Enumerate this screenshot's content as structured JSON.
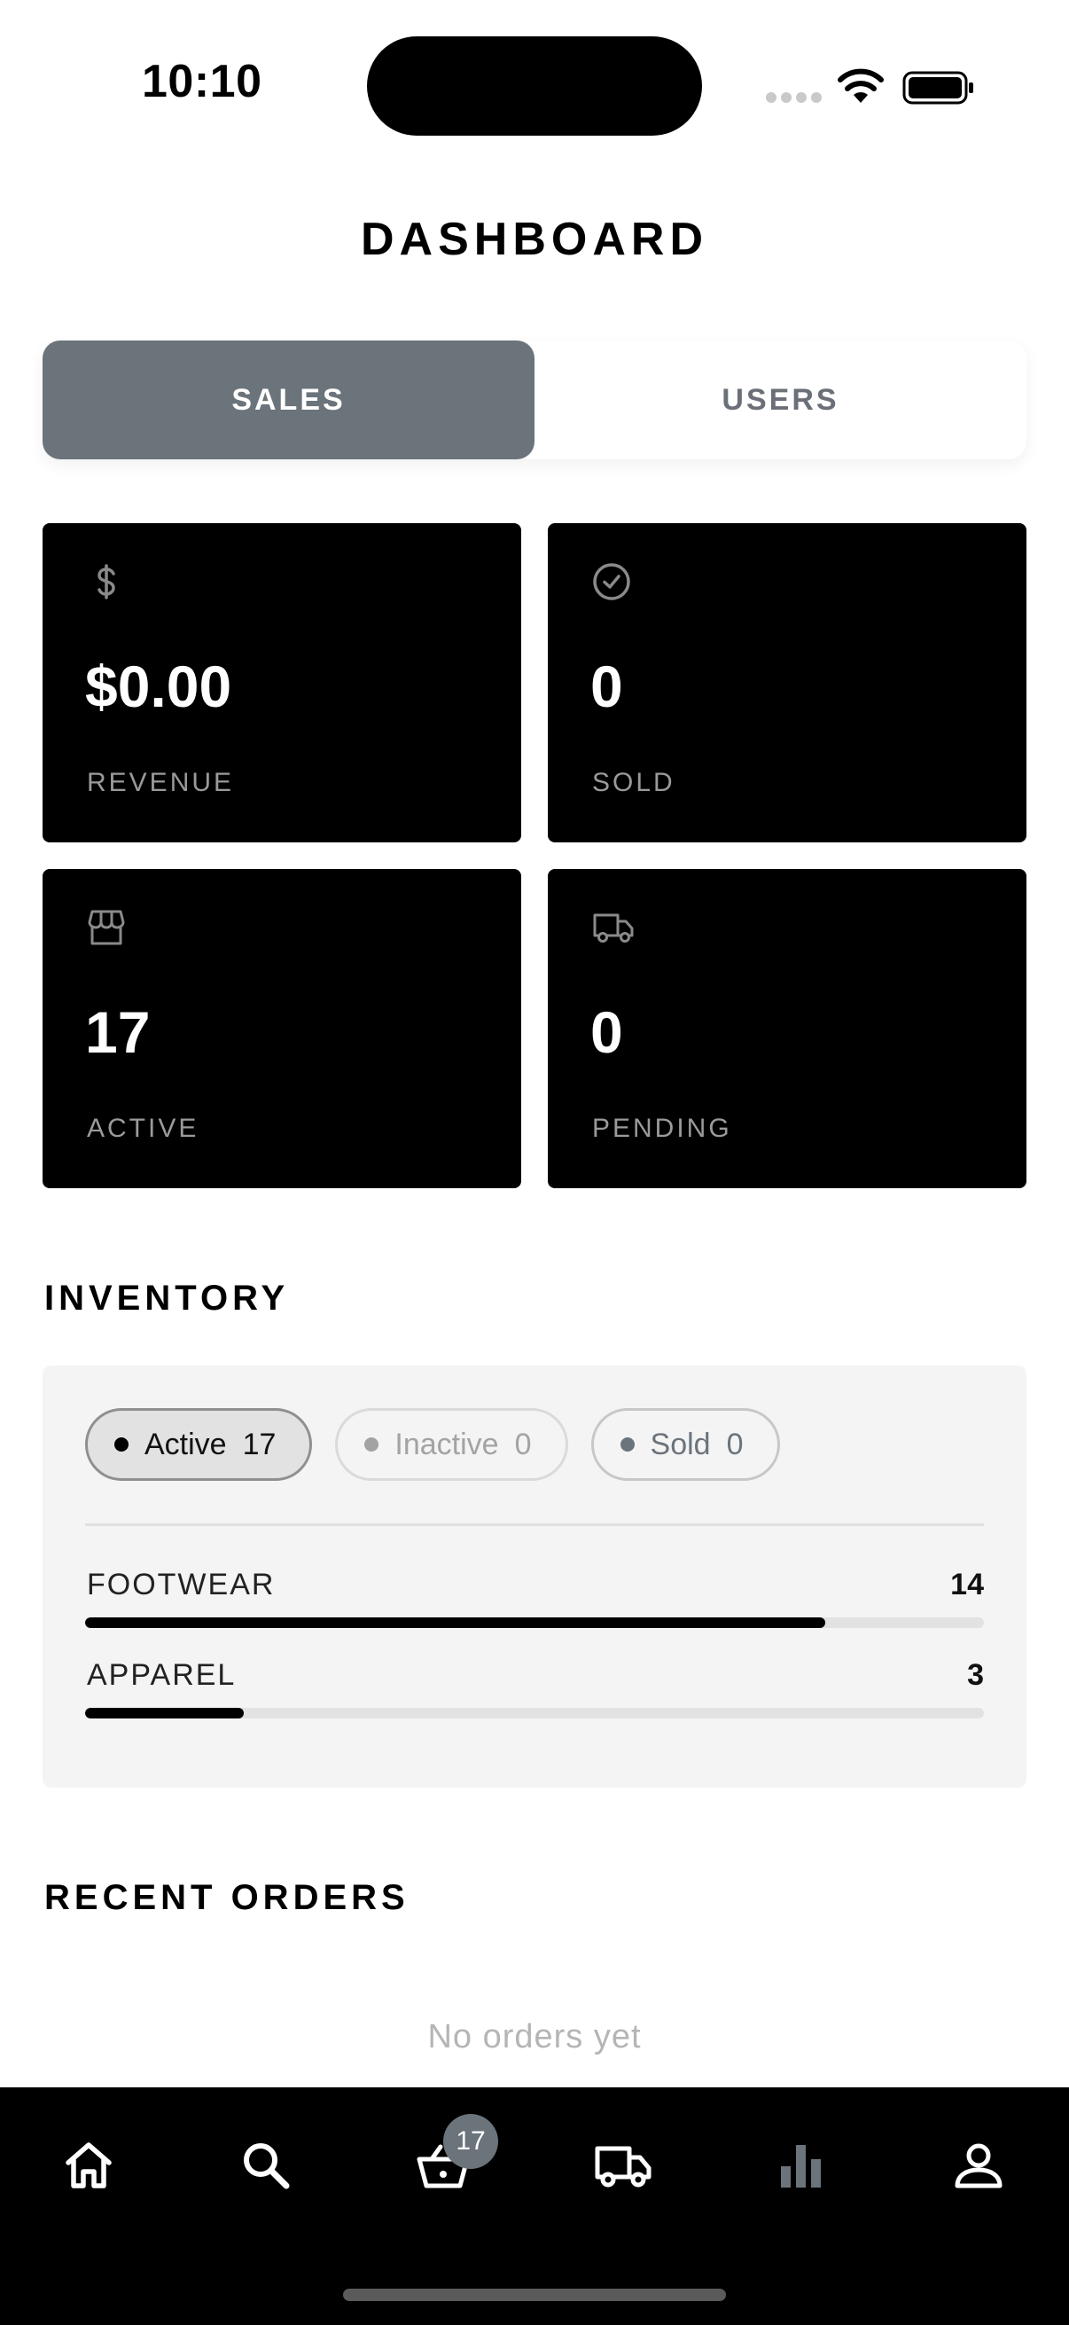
{
  "status_bar": {
    "time": "10:10"
  },
  "title": "DASHBOARD",
  "tabs": [
    {
      "label": "SALES",
      "active": true
    },
    {
      "label": "USERS",
      "active": false
    }
  ],
  "stats": [
    {
      "icon": "dollar-icon",
      "value": "$0.00",
      "label": "REVENUE"
    },
    {
      "icon": "check-circle-icon",
      "value": "0",
      "label": "SOLD"
    },
    {
      "icon": "store-icon",
      "value": "17",
      "label": "ACTIVE"
    },
    {
      "icon": "truck-icon",
      "value": "0",
      "label": "PENDING"
    }
  ],
  "inventory": {
    "title": "INVENTORY",
    "filters": [
      {
        "label": "Active",
        "count": "17"
      },
      {
        "label": "Inactive",
        "count": "0"
      },
      {
        "label": "Sold",
        "count": "0"
      }
    ],
    "categories": [
      {
        "name": "FOOTWEAR",
        "count": "14",
        "fraction": 0.8235
      },
      {
        "name": "APPAREL",
        "count": "3",
        "fraction": 0.1765
      }
    ]
  },
  "recent_orders": {
    "title": "RECENT ORDERS",
    "empty_text": "No orders yet"
  },
  "nav": {
    "items": [
      "home-icon",
      "search-icon",
      "basket-icon",
      "truck-icon",
      "bar-chart-icon",
      "profile-icon"
    ],
    "cart_badge": "17"
  },
  "colors": {
    "accent": "#6b737b",
    "card": "#000000",
    "muted": "#9a9a9a"
  }
}
